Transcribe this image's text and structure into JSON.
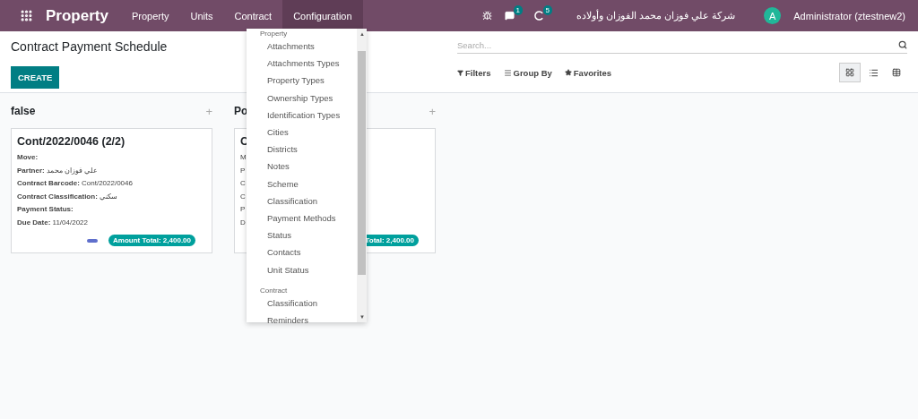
{
  "navbar": {
    "app_name": "Property",
    "menus": [
      {
        "label": "Property",
        "selected": false
      },
      {
        "label": "Units",
        "selected": false
      },
      {
        "label": "Contract",
        "selected": false
      },
      {
        "label": "Configuration",
        "selected": true
      }
    ],
    "chat_count": "1",
    "activity_count": "5",
    "company": "شركة علي فوزان محمد الفوزان وأولاده",
    "avatar_letter": "A",
    "user": "Administrator (ztestnew2)"
  },
  "control_panel": {
    "title": "Contract Payment Schedule",
    "create_label": "CREATE",
    "search_placeholder": "Search...",
    "filters": [
      "Filters",
      "Group By",
      "Favorites"
    ],
    "views": [
      {
        "kind": "kanban",
        "selected": true
      },
      {
        "kind": "list",
        "selected": false
      },
      {
        "kind": "grid",
        "selected": false
      }
    ]
  },
  "columns": [
    {
      "title": "false",
      "cards": [
        {
          "title": "Cont/2022/0046 (2/2)",
          "fields": [
            "**Move:**",
            "**Partner:** علي فوزان محمد",
            "**Contract Barcode:** Cont/2022/0046",
            "**Contract Classification:** سكني",
            "**Payment Status:**",
            "**Due Date:** 11/04/2022"
          ],
          "badge": "Amount Total: 2,400.00",
          "color": "#5f6fcc"
        }
      ],
      "add_label": "+"
    },
    {
      "title": "Po",
      "cards": [
        {
          "title": "C",
          "fields": [
            "M",
            "P",
            "C",
            "C",
            "P",
            "D"
          ],
          "badge": "Total: 2,400.00"
        }
      ],
      "add_label": "+"
    }
  ],
  "menu": {
    "scroll_up": "▲",
    "scroll_down": "▼",
    "sections": [
      {
        "header": "Property",
        "items": [
          "Attachments",
          "Attachments Types",
          "Property Types",
          "Ownership Types",
          "Identification Types",
          "Cities",
          "Districts",
          "Notes",
          "Scheme",
          "Classification",
          "Payment Methods",
          "Status",
          "Contacts",
          "Unit Status"
        ]
      },
      {
        "header": "Contract",
        "items": [
          "Classification",
          "Reminders"
        ]
      }
    ]
  }
}
